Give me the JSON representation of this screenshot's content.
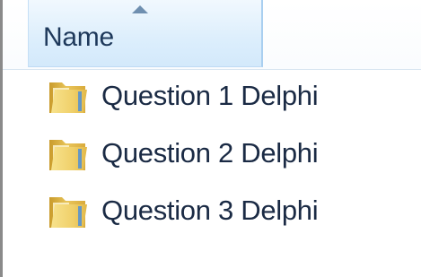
{
  "header": {
    "column_name": "Name",
    "sort_indicator": "sort-ascending-arrow-icon"
  },
  "files": [
    {
      "name": "Question 1 Delphi",
      "icon": "folder-icon"
    },
    {
      "name": "Question 2 Delphi",
      "icon": "folder-icon"
    },
    {
      "name": "Question 3 Delphi",
      "icon": "folder-icon"
    }
  ],
  "colors": {
    "header_text": "#1e395b",
    "header_highlight": "#dceefc",
    "folder_yellow": "#f2d46a",
    "item_text": "#1a2a44"
  }
}
